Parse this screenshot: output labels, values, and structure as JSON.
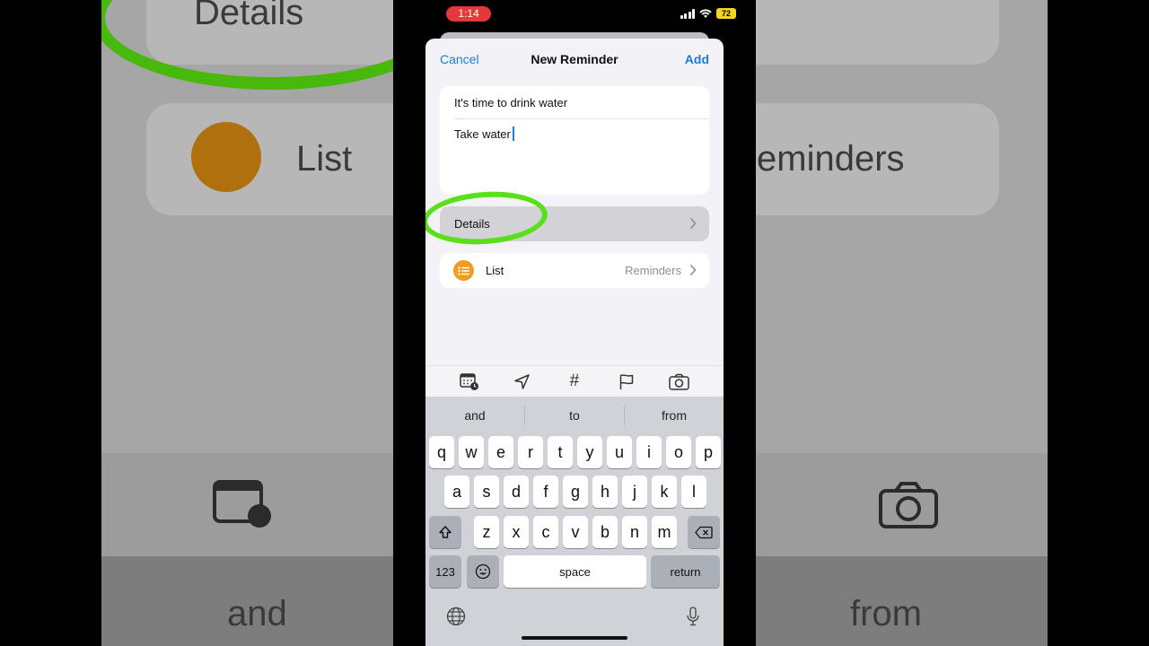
{
  "status_bar": {
    "time": "1:14",
    "battery": "72"
  },
  "background": {
    "top_label": "Details",
    "list_label": "List",
    "list_value": "eminders",
    "suggestion_left": "and",
    "suggestion_right": "from"
  },
  "nav": {
    "cancel": "Cancel",
    "title": "New Reminder",
    "add": "Add"
  },
  "reminder": {
    "title": "It's time to drink water",
    "notes": "Take water"
  },
  "rows": {
    "details_label": "Details",
    "list_label": "List",
    "list_value": "Reminders"
  },
  "toolbar": {
    "icons": [
      "calendar-clock-icon",
      "location-arrow-icon",
      "hashtag-icon",
      "flag-icon",
      "camera-icon"
    ],
    "hashtag": "#"
  },
  "keyboard": {
    "suggestions": [
      "and",
      "to",
      "from"
    ],
    "row1": [
      "q",
      "w",
      "e",
      "r",
      "t",
      "y",
      "u",
      "i",
      "o",
      "p"
    ],
    "row2": [
      "a",
      "s",
      "d",
      "f",
      "g",
      "h",
      "j",
      "k",
      "l"
    ],
    "row3": [
      "z",
      "x",
      "c",
      "v",
      "b",
      "n",
      "m"
    ],
    "numbers_key": "123",
    "space_key": "space",
    "return_key": "return"
  },
  "colors": {
    "accent": "#1f7ad1",
    "annotation": "#5ae01b",
    "list_icon": "#f39b1f",
    "time_pill": "#e5383b"
  }
}
